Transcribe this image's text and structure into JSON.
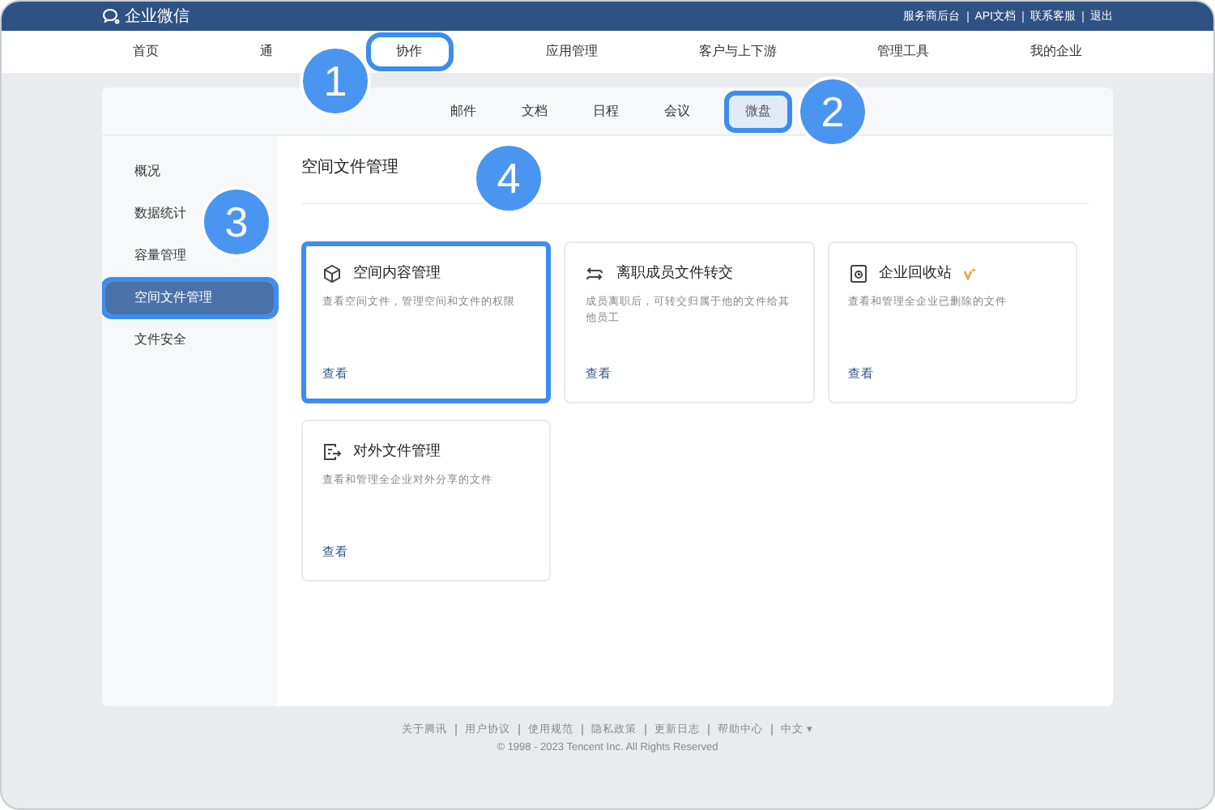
{
  "topbar": {
    "brand": "企业微信",
    "links": [
      "服务商后台",
      "API文档",
      "联系客服",
      "退出"
    ]
  },
  "nav": [
    {
      "label": "首页",
      "highlighted": false
    },
    {
      "label": "通",
      "highlighted": false
    },
    {
      "label": "协作",
      "highlighted": true
    },
    {
      "label": "应用管理",
      "highlighted": false
    },
    {
      "label": "客户与上下游",
      "highlighted": false
    },
    {
      "label": "管理工具",
      "highlighted": false
    },
    {
      "label": "我的企业",
      "highlighted": false
    }
  ],
  "subtabs": [
    {
      "label": "邮件",
      "selected": false,
      "highlighted": false
    },
    {
      "label": "文档",
      "selected": false,
      "highlighted": false
    },
    {
      "label": "日程",
      "selected": false,
      "highlighted": false
    },
    {
      "label": "会议",
      "selected": false,
      "highlighted": false
    },
    {
      "label": "微盘",
      "selected": true,
      "highlighted": true
    }
  ],
  "sidebar": {
    "items": [
      {
        "label": "概况",
        "selected": false,
        "highlighted": false
      },
      {
        "label": "数据统计",
        "selected": false,
        "highlighted": false
      },
      {
        "label": "容量管理",
        "selected": false,
        "highlighted": false
      },
      {
        "label": "空间文件管理",
        "selected": true,
        "highlighted": true
      },
      {
        "label": "文件安全",
        "selected": false,
        "highlighted": false
      }
    ]
  },
  "content": {
    "title": "空间文件管理",
    "cards": [
      {
        "kind": "cube",
        "title": "空间内容管理",
        "description": "查看空间文件，管理空间和文件的权限",
        "link": "查看",
        "vip": false,
        "highlighted": true
      },
      {
        "kind": "transfer",
        "title": "离职成员文件转交",
        "description": "成员离职后，可转交归属于他的文件给其他员工",
        "link": "查看",
        "vip": false,
        "highlighted": false
      },
      {
        "kind": "bin",
        "title": "企业回收站",
        "description": "查看和管理全企业已删除的文件",
        "link": "查看",
        "vip": true,
        "highlighted": false
      },
      {
        "kind": "export",
        "title": "对外文件管理",
        "description": "查看和管理全企业对外分享的文件",
        "link": "查看",
        "vip": false,
        "highlighted": false
      }
    ]
  },
  "footer": {
    "links": [
      "关于腾讯",
      "用户协议",
      "使用规范",
      "隐私政策",
      "更新日志",
      "帮助中心"
    ],
    "language": "中文 ▾",
    "copyright": "© 1998 - 2023 Tencent Inc. All Rights Reserved"
  },
  "callouts": [
    {
      "label": "1"
    },
    {
      "label": "2"
    },
    {
      "label": "3"
    },
    {
      "label": "4"
    }
  ]
}
